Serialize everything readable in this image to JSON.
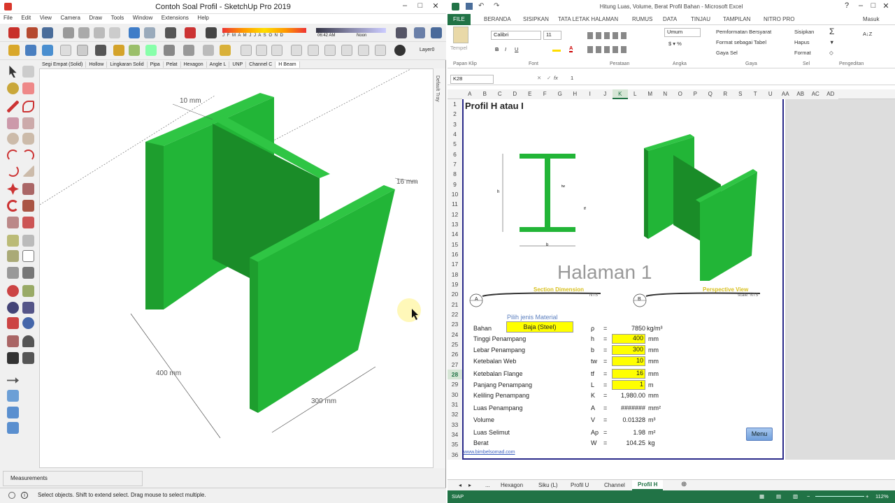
{
  "sketchup": {
    "title": "Contoh Soal Profil - SketchUp Pro 2019",
    "menu": [
      "File",
      "Edit",
      "View",
      "Camera",
      "Draw",
      "Tools",
      "Window",
      "Extensions",
      "Help"
    ],
    "shadow_months": "J F M A M J J A S O N D",
    "time_start": "06:42 AM",
    "time_noon": "Noon",
    "layer": "Layer0",
    "profile_tabs": [
      "Segi Empat (Solid)",
      "Hollow",
      "Lingkaran Solid",
      "Pipa",
      "Pelat",
      "Hexagon",
      "Angle L",
      "UNP",
      "Channel C",
      "H Beam"
    ],
    "active_tab": "H Beam",
    "tray_label": "Default Tray",
    "dim_tf": "10 mm",
    "dim_tw": "16 mm",
    "dim_h": "400 mm",
    "dim_b": "300 mm",
    "measurements_label": "Measurements",
    "status_text": "Select objects. Shift to extend select. Drag mouse to select multiple.",
    "beam_color": "#22b537"
  },
  "excel": {
    "title": "Hitung Luas, Volume, Berat Profil Bahan - Microsoft Excel",
    "user": "Masuk",
    "tabs": [
      "FILE",
      "BERANDA",
      "SISIPKAN",
      "TATA LETAK HALAMAN",
      "RUMUS",
      "DATA",
      "TINJAU",
      "TAMPILAN",
      "NITRO PRO"
    ],
    "ribbon": {
      "paste": "Tempel",
      "font": "Calibri",
      "size": "11",
      "number_format": "Umum",
      "cond_format": "Pemformatan Bersyarat",
      "format_table": "Format sebagai Tabel",
      "cell_style": "Gaya Sel",
      "insert": "Sisipkan",
      "delete": "Hapus",
      "format": "Format",
      "groups": [
        "Papan Klip",
        "Font",
        "Perataan",
        "Angka",
        "Gaya",
        "Sel",
        "Pengeditan"
      ]
    },
    "namebox": "K28",
    "formula": "1",
    "columns": [
      "A",
      "B",
      "C",
      "D",
      "E",
      "F",
      "G",
      "H",
      "I",
      "J",
      "K",
      "L",
      "M",
      "N",
      "O",
      "P",
      "Q",
      "R",
      "S",
      "T",
      "U",
      "AA",
      "AB",
      "AC",
      "AD"
    ],
    "selected_col": "K",
    "rows": [
      "1",
      "2",
      "3",
      "4",
      "5",
      "6",
      "7",
      "8",
      "9",
      "10",
      "11",
      "12",
      "13",
      "14",
      "15",
      "16",
      "17",
      "18",
      "19",
      "20",
      "21",
      "22",
      "23",
      "24",
      "25",
      "26",
      "27",
      "28",
      "29",
      "30",
      "31",
      "32",
      "33",
      "34",
      "35",
      "36"
    ],
    "selected_row": "28",
    "sheet_title": "Profil H atau I",
    "page_watermark": "Halaman 1",
    "section_label": "Section Dimension",
    "section_scale": "NTS",
    "section_marker": "A",
    "perspective_label": "Perspective View",
    "perspective_scale": "scale: NTS",
    "perspective_marker": "B",
    "material_prompt": "Pilih jenis Material",
    "inputs": [
      {
        "label": "Bahan",
        "sym": "",
        "eq": "",
        "value": "Baja (Steel)",
        "unit": ""
      },
      {
        "label": "Tinggi Penampang",
        "sym": "h",
        "eq": "=",
        "value": "400",
        "unit": "mm"
      },
      {
        "label": "Lebar Penampang",
        "sym": "b",
        "eq": "=",
        "value": "300",
        "unit": "mm"
      },
      {
        "label": "Ketebalan Web",
        "sym": "tw",
        "eq": "=",
        "value": "10",
        "unit": "mm"
      },
      {
        "label": "Ketebalan Flange",
        "sym": "tf",
        "eq": "=",
        "value": "16",
        "unit": "mm"
      },
      {
        "label": "Panjang Penampang",
        "sym": "L",
        "eq": "=",
        "value": "1",
        "unit": "m"
      }
    ],
    "density": {
      "sym": "ρ",
      "eq": "=",
      "value": "7850",
      "unit": "kg/m³"
    },
    "outputs": [
      {
        "label": "Keliling Penampang",
        "sym": "K",
        "eq": "=",
        "value": "1,980.00",
        "unit": "mm"
      },
      {
        "label": "Luas Penampang",
        "sym": "A",
        "eq": "=",
        "value": "#######",
        "unit": "mm²"
      },
      {
        "label": "Volume",
        "sym": "V",
        "eq": "=",
        "value": "0.01328",
        "unit": "m³"
      },
      {
        "label": "Luas Selimut",
        "sym": "Ap",
        "eq": "=",
        "value": "1.98",
        "unit": "m²"
      },
      {
        "label": "Berat",
        "sym": "W",
        "eq": "=",
        "value": "104.25",
        "unit": "kg"
      }
    ],
    "menu_button": "Menu",
    "website": "www.bimbelsomad.com",
    "sheet_tabs": [
      "...",
      "Hexagon",
      "Siku (L)",
      "Profil U",
      "Channel",
      "Profil H"
    ],
    "active_sheet": "Profil H",
    "status_mode": "SIAP",
    "zoom": "112%",
    "accent": "#217346"
  }
}
